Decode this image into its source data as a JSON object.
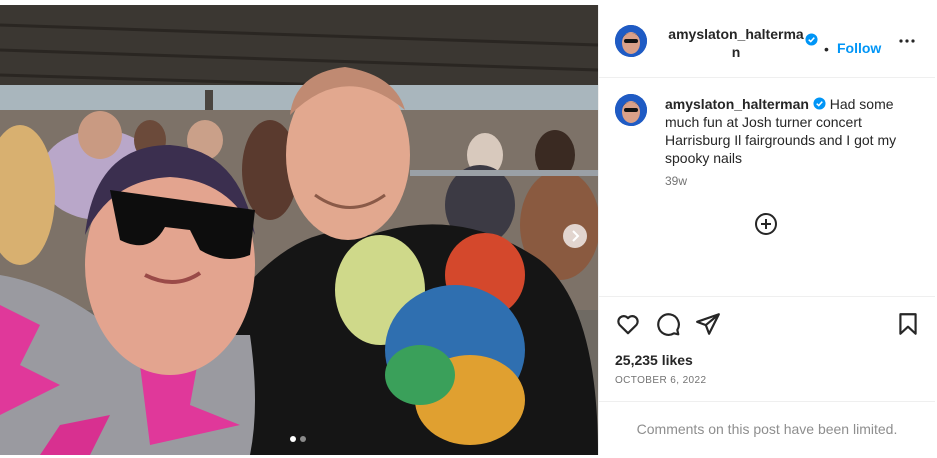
{
  "post": {
    "username_header": "amyslaton_halterman",
    "follow_label": "Follow",
    "separator": "•",
    "caption_username": "amyslaton_halterman",
    "caption_text": "Had some much fun at Josh turner concert Harrisburg Il fairgrounds and I got my spooky nails",
    "time_ago": "39w",
    "likes": "25,235 likes",
    "date": "OCTOBER 6, 2022",
    "comments_limited": "Comments on this post have been limited."
  },
  "carousel": {
    "current": 1,
    "total": 2
  },
  "icons": {
    "verified": "verified-badge-icon",
    "more": "more-options-icon",
    "add_comment": "plus-circle-icon",
    "like": "heart-icon",
    "comment": "comment-bubble-icon",
    "share": "paper-plane-icon",
    "save": "bookmark-icon",
    "next": "chevron-right-icon"
  },
  "colors": {
    "accent": "#0095f6",
    "verified": "#0095f6",
    "muted": "#737373"
  }
}
